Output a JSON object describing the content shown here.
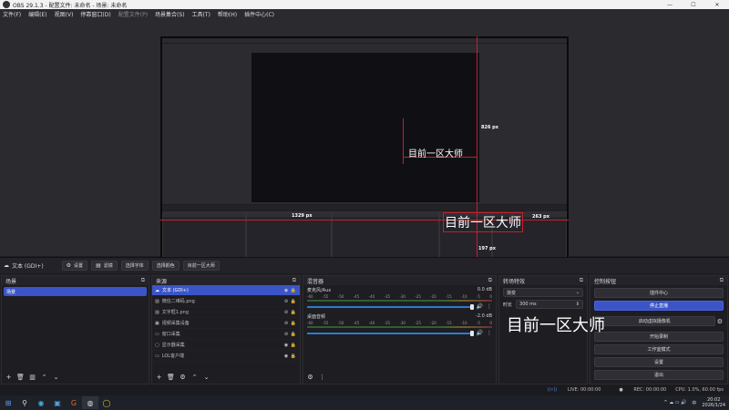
{
  "window": {
    "title": "OBS 29.1.3 - 配置文件: 未命名 - 场景: 未命名",
    "minimize": "—",
    "maximize": "☐",
    "close": "✕"
  },
  "menu": [
    "文件(F)",
    "编辑(E)",
    "视图(V)",
    "停靠窗口(D)",
    "配置文件(P)",
    "场景集合(S)",
    "工具(T)",
    "帮助(H)",
    "插件中心(C)"
  ],
  "menu_disabled": [
    "配置文件(P)"
  ],
  "preview": {
    "measure_v": "826 px",
    "measure_h": "1329 px",
    "measure_small_v": "197 px",
    "measure_small_h": "263 px",
    "overlay_text": "目前一区大师"
  },
  "source_toolbar": {
    "source_name": "文本 (GDI+)",
    "buttons": [
      {
        "icon": "gear-icon",
        "label": "设置"
      },
      {
        "icon": "filter-icon",
        "label": "滤镜"
      },
      {
        "icon": "",
        "label": "选择字体"
      },
      {
        "icon": "",
        "label": "选择颜色"
      },
      {
        "icon": "",
        "label": "目前一区大师"
      }
    ]
  },
  "scenes": {
    "title": "场景",
    "items": [
      "场景"
    ]
  },
  "sources": {
    "title": "来源",
    "items": [
      {
        "name": "文本 (GDI+)",
        "icon": "text-icon",
        "visible": true,
        "selected": true
      },
      {
        "name": "微信二维码.png",
        "icon": "image-icon",
        "visible": false,
        "selected": false
      },
      {
        "name": "文字框1.png",
        "icon": "image-icon",
        "visible": false,
        "selected": false
      },
      {
        "name": "视频采集设备",
        "icon": "camera-icon",
        "visible": false,
        "selected": false
      },
      {
        "name": "窗口采集",
        "icon": "window-icon",
        "visible": false,
        "selected": false
      },
      {
        "name": "显示器采集",
        "icon": "monitor-icon",
        "visible": true,
        "selected": false
      },
      {
        "name": "LOL客户端",
        "icon": "window-icon",
        "visible": true,
        "selected": false
      }
    ]
  },
  "mixer": {
    "title": "混音器",
    "scale": [
      "-60",
      "-55",
      "-50",
      "-45",
      "-40",
      "-35",
      "-30",
      "-25",
      "-20",
      "-15",
      "-10",
      "-5",
      "0"
    ],
    "channels": [
      {
        "name": "麦克风/Aux",
        "db": "0.0 dB",
        "volume": 1.0
      },
      {
        "name": "桌面音频",
        "db": "-2.0 dB",
        "volume": 0.9
      }
    ]
  },
  "transitions": {
    "title": "转场特效",
    "type": "渐变",
    "duration_label": "时长",
    "duration": "300 ms"
  },
  "controls": {
    "title": "控制按钮",
    "buttons": [
      {
        "label": "插件中心",
        "active": false
      },
      {
        "label": "停止直播",
        "active": true
      },
      {
        "label": "启动虚拟摄像机",
        "active": false
      },
      {
        "label": "开始录制",
        "active": false
      },
      {
        "label": "工作室模式",
        "active": false
      },
      {
        "label": "设置",
        "active": false
      },
      {
        "label": "退出",
        "active": false
      }
    ]
  },
  "status": {
    "live": "LIVE: 00:00:00",
    "rec": "REC: 00:00:00",
    "cpu": "CPU: 1.0%, 60.00 fps"
  },
  "taskbar": {
    "time": "20:02",
    "date": "2026/1/24",
    "lang": "中",
    "status_icons": "^ ☁ ▭ 🔊"
  }
}
